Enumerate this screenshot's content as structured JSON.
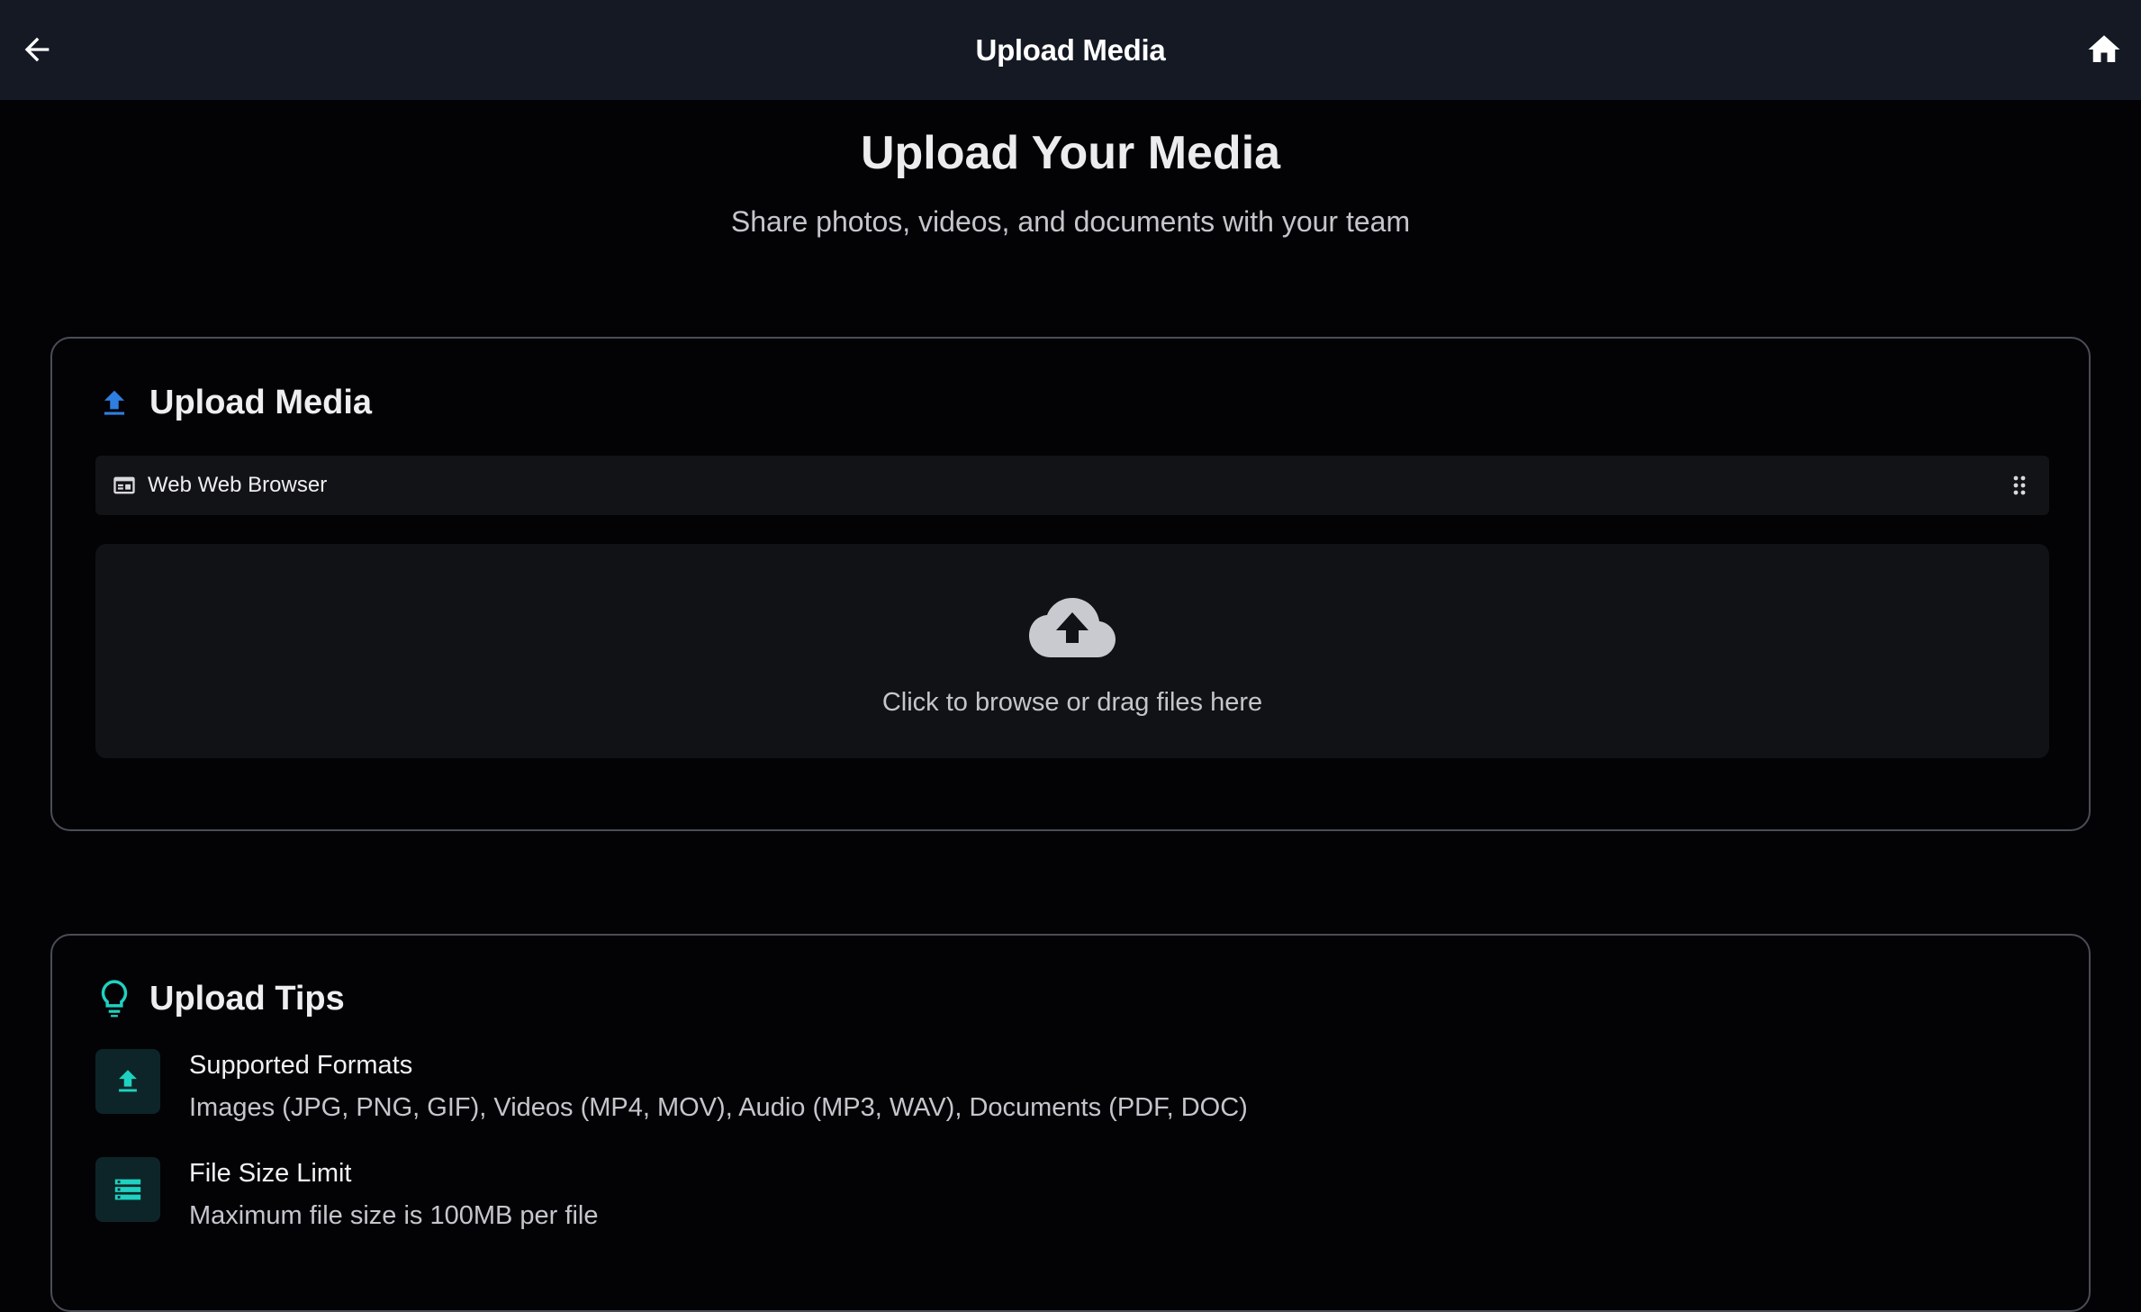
{
  "appbar": {
    "title": "Upload Media",
    "back_icon": "arrow-left-icon",
    "home_icon": "home-icon"
  },
  "hero": {
    "title": "Upload Your Media",
    "subtitle": "Share photos, videos, and documents with your team"
  },
  "upload_card": {
    "title": "Upload Media",
    "icon": "upload-icon",
    "source": {
      "label": "Web Web Browser",
      "icon": "browser-window-icon",
      "menu_icon": "drag-handle-icon"
    },
    "dropzone": {
      "icon": "cloud-upload-icon",
      "text": "Click to browse or drag files here"
    }
  },
  "tips_card": {
    "title": "Upload Tips",
    "icon": "lightbulb-icon",
    "items": [
      {
        "icon": "upload-icon",
        "title": "Supported Formats",
        "description": "Images (JPG, PNG, GIF), Videos (MP4, MOV), Audio (MP3, WAV), Documents (PDF, DOC)"
      },
      {
        "icon": "storage-icon",
        "title": "File Size Limit",
        "description": "Maximum file size is 100MB per file"
      }
    ]
  },
  "colors": {
    "appbar_bg": "#141923",
    "page_bg": "#030306",
    "accent_blue": "#2f7fe0",
    "accent_teal": "#1fd1c0",
    "card_border": "#4a4d55"
  }
}
